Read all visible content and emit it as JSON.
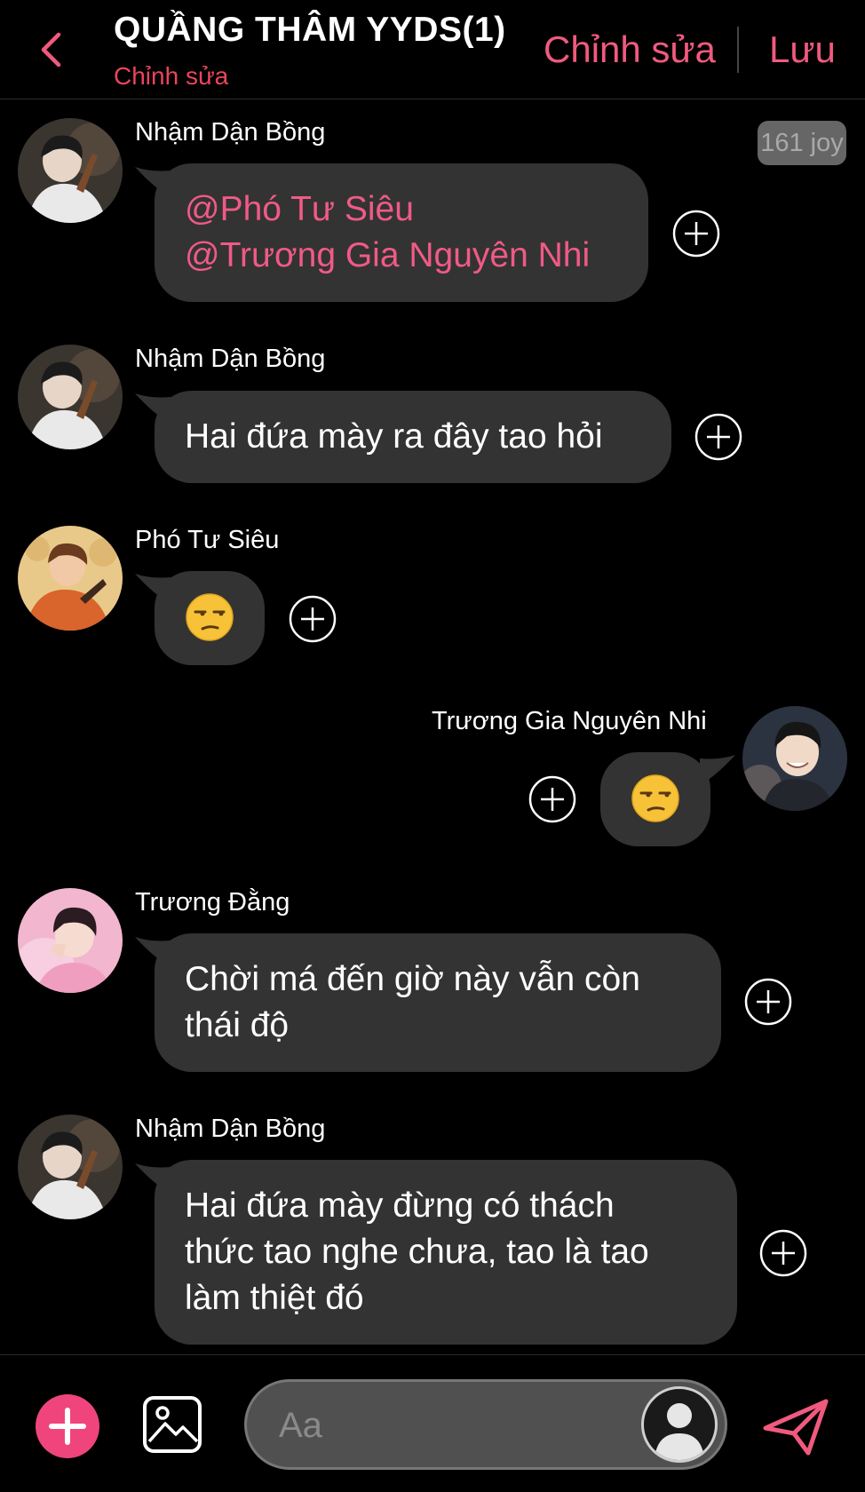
{
  "header": {
    "title": "QUẦNG THÂM YYDS(1)",
    "subtitle": "Chỉnh sửa",
    "edit_label": "Chỉnh sửa",
    "save_label": "Lưu"
  },
  "badge": {
    "joy_label": "161 joy"
  },
  "messages": [
    {
      "sender": "Nhậm Dận Bồng",
      "lines": [
        "@Phó Tư Siêu",
        "@Trương Gia Nguyên Nhi"
      ]
    },
    {
      "sender": "Nhậm Dận Bồng",
      "lines": [
        "Hai đứa mày ra đây tao hỏi"
      ]
    },
    {
      "sender": "Phó Tư Siêu",
      "emoji": "unamused-face"
    },
    {
      "sender": "Trương Gia Nguyên Nhi",
      "emoji": "unamused-face"
    },
    {
      "sender": "Trương Đằng",
      "lines": [
        "Chời má đến giờ này vẫn còn",
        "thái độ"
      ]
    },
    {
      "sender": "Nhậm Dận Bồng",
      "lines": [
        "Hai đứa mày đừng có thách",
        "thức tao nghe chưa, tao là tao",
        "làm thiệt đó"
      ]
    }
  ],
  "composer": {
    "placeholder": "Aa"
  },
  "colors": {
    "accent": "#f05a7e",
    "bubble": "#333333",
    "mention": "#f05a86",
    "add_button": "#f0457c"
  }
}
